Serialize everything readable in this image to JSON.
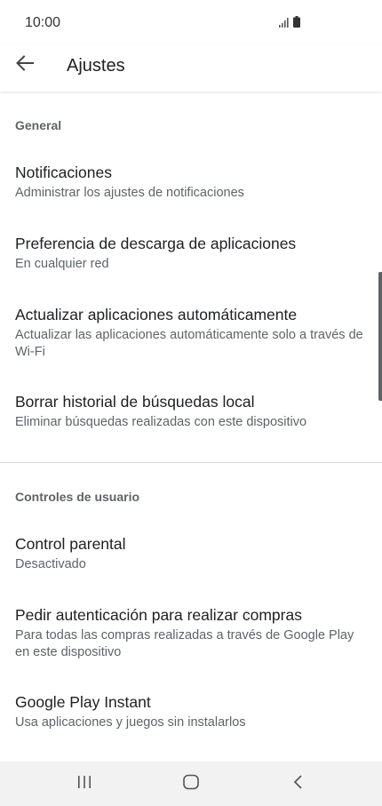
{
  "status_bar": {
    "time": "10:00",
    "icons": [
      "signal-icon",
      "battery-icon"
    ]
  },
  "app_bar": {
    "back_icon": "arrow-left-icon",
    "title": "Ajustes"
  },
  "sections": [
    {
      "header": "General",
      "items": [
        {
          "title": "Notificaciones",
          "subtitle": "Administrar los ajustes de notificaciones"
        },
        {
          "title": "Preferencia de descarga de aplicaciones",
          "subtitle": "En cualquier red"
        },
        {
          "title": "Actualizar aplicaciones automáticamente",
          "subtitle": "Actualizar las aplicaciones automáticamente solo a través de Wi-Fi"
        },
        {
          "title": "Borrar historial de búsquedas local",
          "subtitle": "Eliminar búsquedas realizadas con este dispositivo"
        }
      ]
    },
    {
      "header": "Controles de usuario",
      "items": [
        {
          "title": "Control parental",
          "subtitle": "Desactivado"
        },
        {
          "title": "Pedir autenticación para realizar compras",
          "subtitle": "Para todas las compras realizadas a través de Google Play en este dispositivo"
        },
        {
          "title": "Google Play Instant",
          "subtitle": "Usa aplicaciones y juegos sin instalarlos"
        }
      ]
    }
  ],
  "nav_bar": {
    "buttons": [
      "recents-icon",
      "home-icon",
      "back-icon"
    ]
  },
  "colors": {
    "text_primary": "#202124",
    "text_secondary": "#5f6368",
    "divider": "#dadce0",
    "nav_background": "#f2f2f2"
  }
}
